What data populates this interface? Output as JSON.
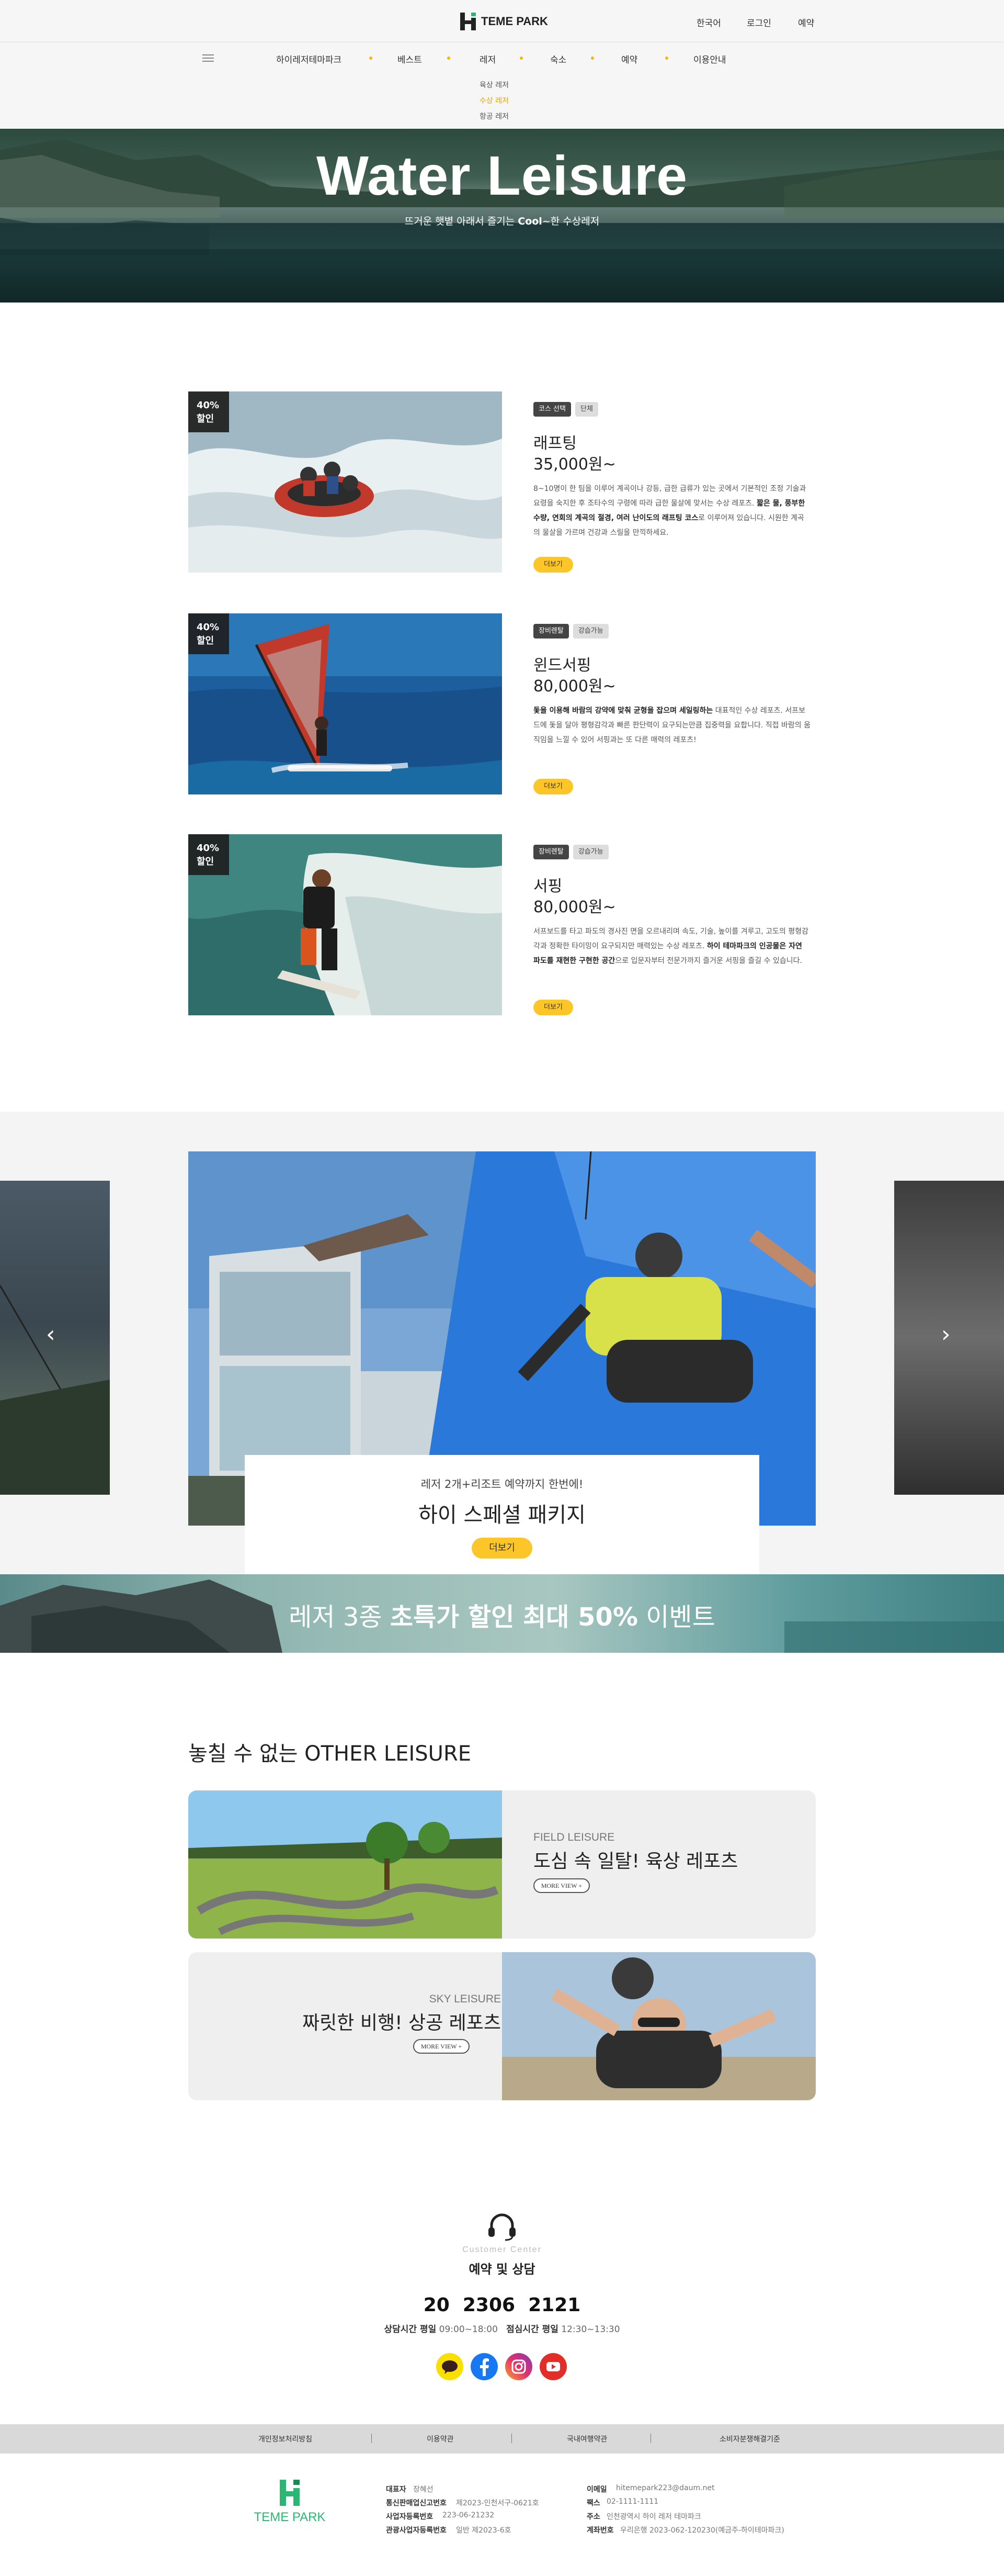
{
  "header": {
    "brand": "TEME PARK",
    "util": [
      "한국어",
      "로그인",
      "예약"
    ],
    "nav": [
      "하이레저테마파크",
      "베스트",
      "레저",
      "숙소",
      "예약",
      "이용안내"
    ],
    "submenu": [
      "육상 레저",
      "수상 레저",
      "항공 레저"
    ],
    "submenu_active": 1
  },
  "hero": {
    "title": "Water Leisure",
    "subtitle_pre": "뜨거운 햇볕 아래서 즐기는 ",
    "subtitle_em": "Cool",
    "subtitle_post": "~한 수상레저"
  },
  "products": [
    {
      "badge_line1": "40%",
      "badge_line2": "할인",
      "tags": [
        "코스 선택",
        "단체"
      ],
      "name": "래프팅",
      "price": "35,000원~",
      "desc1": "8~10명이 한 팀을 이루어 계곡이나 강등, 급한 급류가 있는 곳에서 기본적인 조정 기술과 요령을 숙지한 후 조타수의 구령에 따라 급한 물살에 맞서는 수상 레포츠.",
      "desc_bold": "짧은 물, 풍부한 수량, 연회의 계곡의 절경, 여러 난이도의 래프팅 코스",
      "desc2": "로 이루어져 있습니다. 시원한 계곡의 물살을 가르며 건강과 스릴을 만끽하세요.",
      "more": "더보기"
    },
    {
      "badge_line1": "40%",
      "badge_line2": "할인",
      "tags": [
        "장비렌탈",
        "강습가능"
      ],
      "name": "윈드서핑",
      "price": "80,000원~",
      "desc_bold": "돛을 이용해 바람의 강약에 맞춰 균형을 잡으며 세일링하는",
      "desc2": " 대표적인 수상 레포츠. 서프보드에 돛을 달아 평형감각과 빠른 판단력이 요구되는만큼 집중력을 요합니다. 직접 바람의 움직임을 느낄 수 있어 서핑과는 또 다른 매력의 레포츠!",
      "more": "더보기"
    },
    {
      "badge_line1": "40%",
      "badge_line2": "할인",
      "tags": [
        "장비렌탈",
        "강습가능"
      ],
      "name": "서핑",
      "price": "80,000원~",
      "desc1": "서프보드를 타고 파도의 경사진 면을 오르내리며 속도, 기술, 높이를 겨루고, 고도의 평형감각과 정확한 타이밍이 요구되지만 매력있는 수상 레포츠.",
      "desc_bold": "하이 테마파크의 인공물은 자연 파도를 재현한 구현한 공간",
      "desc2": "으로 입문자부터 전문가까지 즐거운 서핑을 즐길 수 있습니다.",
      "more": "더보기"
    }
  ],
  "package": {
    "sub": "레저 2개+리조트 예약까지 한번에!",
    "title": "하이 스페셜 패키지",
    "more": "더보기",
    "prev": "‹",
    "next": "›"
  },
  "banner": {
    "pre": "레저 3종 ",
    "bold": "초특가 할인 최대 50%",
    "post": " 이벤트"
  },
  "other": {
    "title": "놓칠 수 없는 OTHER LEISURE",
    "cards": [
      {
        "eng": "FIELD LEISURE",
        "kor": "도심 속 일탈! 육상 레포츠",
        "btn": "MORE VIEW +"
      },
      {
        "eng": "SKY LEISURE",
        "kor": "짜릿한 비행! 상공 레포츠",
        "btn": "MORE VIEW +"
      }
    ]
  },
  "cs": {
    "eng": "Customer Center",
    "title": "예약 및 상담",
    "phone": "20  2306  2121",
    "hours_label1": "상담시간 평일",
    "hours_val1": "09:00~18:00",
    "hours_label2": "점심시간 평일",
    "hours_val2": "12:30~13:30"
  },
  "sns": [
    "kakao-icon",
    "facebook-icon",
    "instagram-icon",
    "youtube-icon"
  ],
  "policy": [
    "개인정보처리방침",
    "이용약관",
    "국내여행약관",
    "소비자분쟁해결기준"
  ],
  "footer": {
    "brand": "TEME PARK",
    "col1": [
      {
        "label": "대표자",
        "value": "장혜선"
      },
      {
        "label": "통신판매업신고번호",
        "value": "제2023-인천서구-0621호"
      },
      {
        "label": "사업자등록번호",
        "value": "223-06-21232"
      },
      {
        "label": "관광사업자등록번호",
        "value": "일반 제2023-6호"
      }
    ],
    "col2": [
      {
        "label": "이메일",
        "value": "hitemepark223@daum.net"
      },
      {
        "label": "팩스",
        "value": "02-1111-1111"
      },
      {
        "label": "주소",
        "value": "인천광역시 하이 레저 테마파크"
      },
      {
        "label": "계좌번호",
        "value": "우리은행 2023-062-120230(예금주-하이테마파크)"
      }
    ]
  },
  "colors": {
    "accent": "#fcc629",
    "brand_green": "#2bb673",
    "dark": "#222222"
  }
}
